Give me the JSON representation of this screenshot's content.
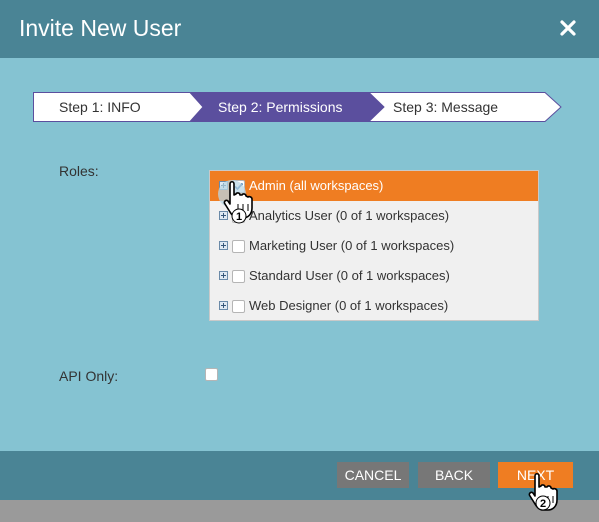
{
  "dialog": {
    "title": "Invite New User"
  },
  "wizard": {
    "steps": [
      {
        "label": "Step 1: INFO",
        "active": false
      },
      {
        "label": "Step 2: Permissions",
        "active": true
      },
      {
        "label": "Step 3: Message",
        "active": false
      }
    ]
  },
  "form": {
    "roles_label": "Roles:",
    "api_only_label": "API Only:",
    "api_only_checked": false
  },
  "roles": [
    {
      "label": "Admin (all workspaces)",
      "checked": true,
      "selected": true
    },
    {
      "label": "Analytics User (0 of 1 workspaces)",
      "checked": false,
      "selected": false
    },
    {
      "label": "Marketing User (0 of 1 workspaces)",
      "checked": false,
      "selected": false
    },
    {
      "label": "Standard User (0 of 1 workspaces)",
      "checked": false,
      "selected": false
    },
    {
      "label": "Web Designer (0 of 1 workspaces)",
      "checked": false,
      "selected": false
    }
  ],
  "footer": {
    "cancel_label": "CANCEL",
    "back_label": "BACK",
    "next_label": "NEXT"
  },
  "annotations": {
    "step1_number": "1",
    "step2_number": "2"
  },
  "colors": {
    "accent": "#ef7d22",
    "header": "#4a8495",
    "body": "#85c3d2",
    "wizard_active": "#5b4f9e",
    "button_grey": "#777777"
  }
}
